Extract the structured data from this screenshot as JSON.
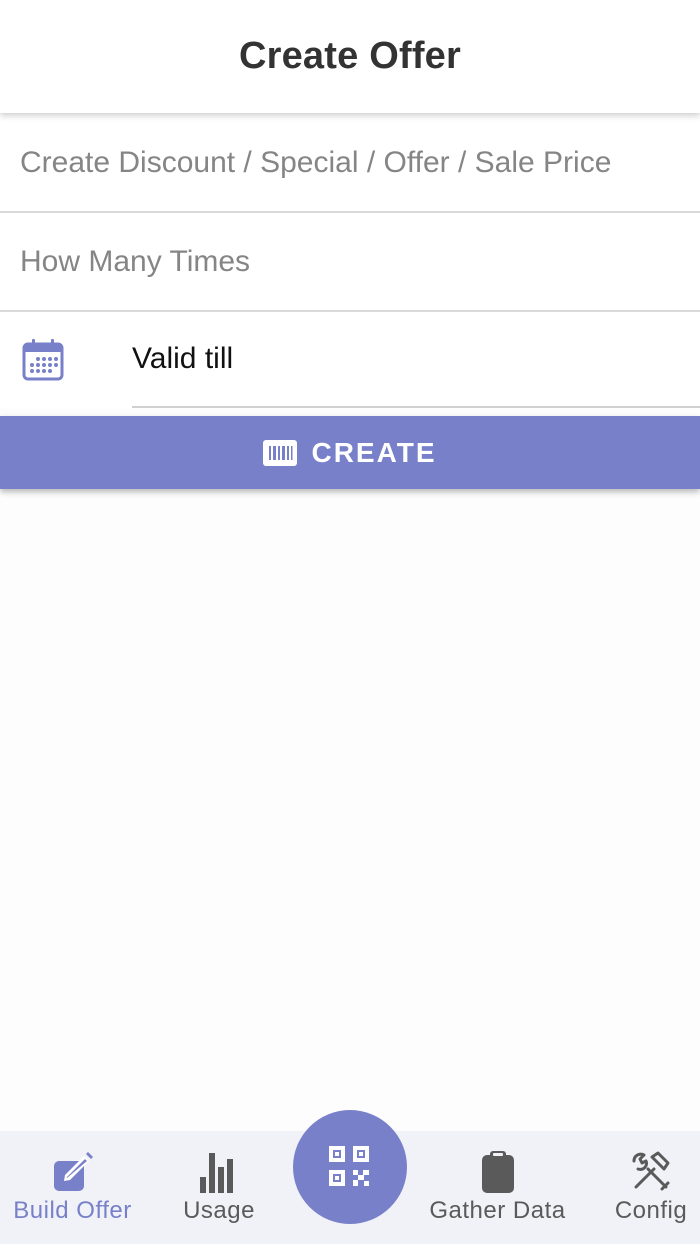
{
  "appbar": {
    "title": "Create Offer"
  },
  "form": {
    "discount_placeholder": "Create Discount / Special / Offer / Sale Price",
    "times_placeholder": "How Many Times",
    "valid_till_label": "Valid till",
    "calendar_icon": "calendar-icon"
  },
  "create_button": {
    "label": "CREATE",
    "icon": "barcode-icon"
  },
  "bottom_nav": {
    "items": [
      {
        "label": "Build Offer",
        "icon": "edit-icon",
        "active": true
      },
      {
        "label": "Usage",
        "icon": "bar-chart-icon",
        "active": false
      },
      {
        "label": "Gather Data",
        "icon": "clipboard-icon",
        "active": false
      },
      {
        "label": "Config",
        "icon": "tools-icon",
        "active": false
      }
    ],
    "center_button_icon": "qr-code-icon"
  },
  "colors": {
    "accent": "#7880c9",
    "nav_background": "#f1f2f8",
    "inactive_icon": "#5a5a5a"
  }
}
